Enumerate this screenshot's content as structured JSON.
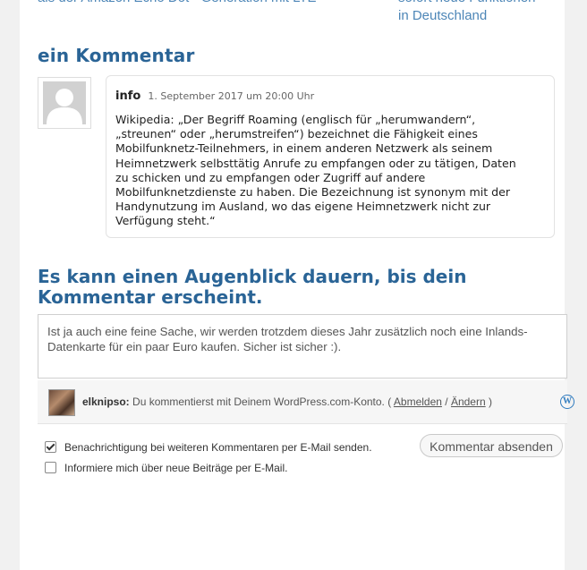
{
  "post_nav": {
    "prev_label": "als der Amazon Echo Dot - Generation mit LTE",
    "next_line1": "sofort neue Funktionen",
    "next_line2": "in Deutschland"
  },
  "comments": {
    "title": "ein Kommentar",
    "items": [
      {
        "author": "info",
        "date": "1. September 2017 um 20:00 Uhr",
        "text": "Wikipedia: „Der Begriff Roaming (englisch für „herumwandern“,\n„streunen“ oder „herumstreifen“) bezeichnet die Fähigkeit eines\nMobilfunknetz-Teilnehmers, in einem anderen Netzwerk als seinem\nHeimnetzwerk selbsttätig Anrufe zu empfangen oder zu tätigen, Daten\nzu schicken und zu empfangen oder Zugriff auf andere\nMobilfunknetzdienste zu haben. Die Bezeichnung ist synonym mit der\nHandynutzung im Ausland, wo das eigene Heimnetzwerk nicht zur\nVerfügung steht.“"
      }
    ]
  },
  "reply": {
    "title": "Es kann einen Augenblick dauern, bis dein Kommentar erscheint.",
    "textarea_value": "Ist ja auch eine feine Sache, wir werden trotzdem dieses Jahr zusätzlich noch eine Inlands-Datenkarte für ein paar Euro kaufen. Sicher ist sicher :).",
    "identity": {
      "username": "elknipso:",
      "message": " Du kommentierst mit Deinem WordPress.com-Konto. ( ",
      "logout_label": "Abmelden",
      "separator": " / ",
      "change_label": "Ändern",
      "close": " )",
      "service_icon": "wordpress-icon"
    },
    "notify_comments_label": "Benachrichtigung bei weiteren Kommentaren per E-Mail senden.",
    "notify_comments_checked": true,
    "notify_posts_label": "Informiere mich über neue Beiträge per E-Mail.",
    "notify_posts_checked": false,
    "submit_label": "Kommentar absenden"
  }
}
